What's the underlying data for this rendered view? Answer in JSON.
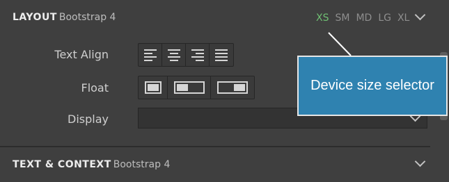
{
  "layout": {
    "title": "LAYOUT",
    "subtitle": "Bootstrap 4",
    "device_sizes": [
      "XS",
      "SM",
      "MD",
      "LG",
      "XL"
    ],
    "active_device": "XS",
    "rows": {
      "text_align_label": "Text Align",
      "float_label": "Float",
      "display_label": "Display"
    },
    "display_value": ""
  },
  "text_context": {
    "title": "TEXT & CONTEXT",
    "subtitle": "Bootstrap 4"
  },
  "annotation": {
    "text": "Device size selector"
  },
  "colors": {
    "panel_bg": "#3f3f3f",
    "active_device": "#6fbf73",
    "tooltip_bg": "#2f82b0"
  },
  "icons": {
    "align_left": "align-left-icon",
    "align_center": "align-center-icon",
    "align_right": "align-right-icon",
    "align_justify": "align-justify-icon",
    "float_none": "float-none-icon",
    "float_left": "float-left-icon",
    "float_right": "float-right-icon"
  }
}
